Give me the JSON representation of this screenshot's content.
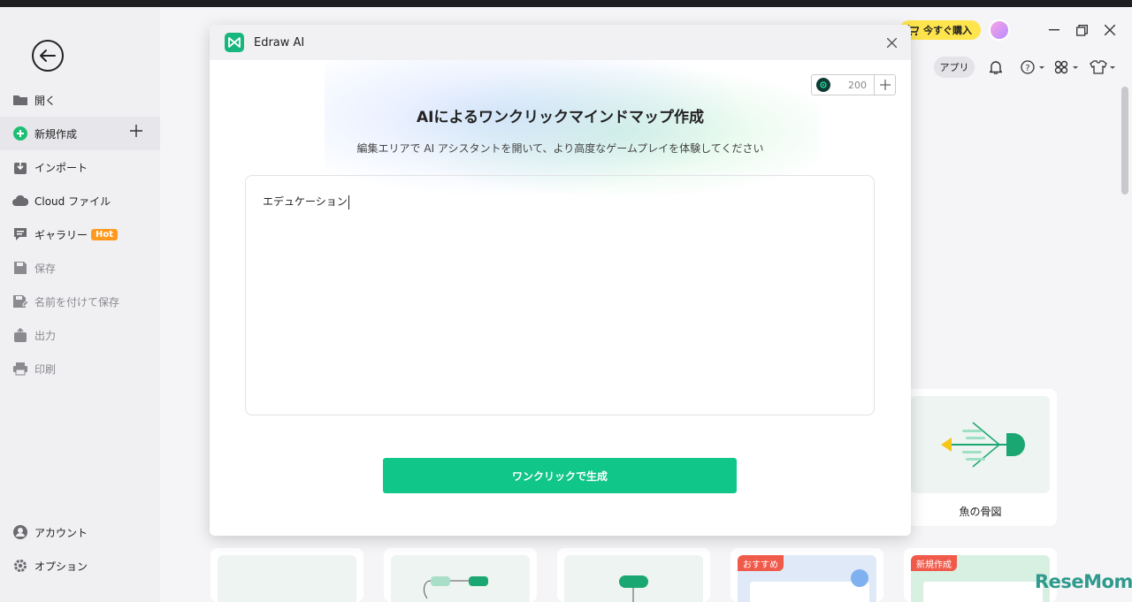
{
  "sidebar": {
    "items": [
      {
        "label": "開く",
        "icon": "folder-icon"
      },
      {
        "label": "新規作成",
        "icon": "add-circle-icon"
      },
      {
        "label": "インポート",
        "icon": "import-icon"
      },
      {
        "label": "Cloud ファイル",
        "icon": "cloud-icon"
      },
      {
        "label": "ギャラリー",
        "icon": "gallery-icon",
        "badge": "Hot"
      },
      {
        "label": "保存",
        "icon": "save-icon"
      },
      {
        "label": "名前を付けて保存",
        "icon": "save-as-icon"
      },
      {
        "label": "出力",
        "icon": "export-icon"
      },
      {
        "label": "印刷",
        "icon": "print-icon"
      }
    ],
    "bottom_items": [
      {
        "label": "アカウント",
        "icon": "account-icon"
      },
      {
        "label": "オプション",
        "icon": "settings-icon"
      }
    ]
  },
  "topbar": {
    "buy_label": "今すぐ購入",
    "app_label": "アプリ"
  },
  "cards": {
    "fishbone_label": "魚の骨図",
    "tag_recommended": "おすすめ",
    "tag_new": "新規作成"
  },
  "dialog": {
    "title": "Edraw AI",
    "credits": "200",
    "heading": "AIによるワンクリックマインドマップ作成",
    "subheading": "編集エリアで AI アシスタントを開いて、より高度なゲームプレイを体験してください",
    "prompt_value": "エデュケーション",
    "generate_label": "ワンクリックで生成"
  },
  "watermark": "ReseMom",
  "colors": {
    "accent": "#10c688",
    "buy": "#ffe54d",
    "hot": "#ff9a1f",
    "tag": "#f05a4a"
  }
}
